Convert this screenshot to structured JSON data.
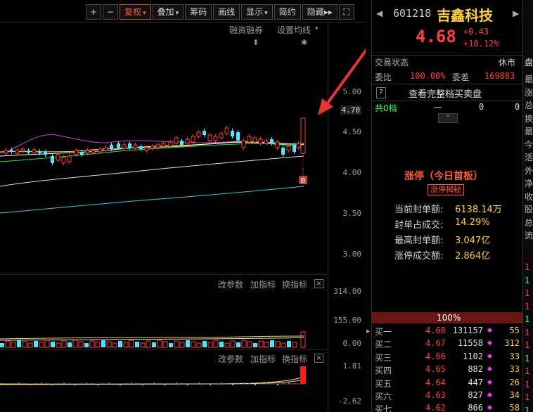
{
  "toolbar": {
    "items": [
      {
        "name": "zoom-in-button",
        "label": "+"
      },
      {
        "name": "zoom-out-button",
        "label": "−"
      },
      {
        "name": "restore-rights-button",
        "label": "复权",
        "caret": "▾"
      },
      {
        "name": "overlay-button",
        "label": "叠加",
        "caret": "▾"
      },
      {
        "name": "chips-button",
        "label": "筹码"
      },
      {
        "name": "draw-line-button",
        "label": "画线"
      },
      {
        "name": "display-button",
        "label": "显示",
        "caret": "▾"
      },
      {
        "name": "simple-button",
        "label": "简约"
      },
      {
        "name": "hide-button",
        "label": "隐藏▸▸"
      },
      {
        "name": "fullscreen-button",
        "label": "⛶"
      }
    ]
  },
  "chart": {
    "margin_trading_label": "融资融券",
    "ma_settings_label": "设置均线",
    "price_ticks": [
      "5.00",
      "4.70",
      "4.50",
      "4.00",
      "3.50",
      "3.00"
    ],
    "buy_marker": "B",
    "volume_ticks": [
      "314.00",
      "155.00",
      "0.00"
    ],
    "macd_ticks": [
      "1.81",
      "-2.62"
    ],
    "panel_links": {
      "edit_params": "改参数",
      "add_indicator": "加指标",
      "switch_indicator": "换指标",
      "close": "×"
    }
  },
  "quote": {
    "code": "601218",
    "name": "吉鑫科技",
    "price": "4.68",
    "change": "+0.43",
    "change_pct": "+10.12%",
    "trade_status_label": "交易状态",
    "trade_status_value": "休市",
    "ratio_label": "委比",
    "ratio_value": "100.00%",
    "diff_label": "委差",
    "diff_value": "169883",
    "view_full_label": "查看完整档买卖盘",
    "help_icon": "?",
    "sell_total_label": "共0档",
    "sell_dash": "—",
    "sell_zero1": "0",
    "sell_zero2": "0",
    "limit_up_title": "涨停（今日首板）",
    "limit_up_reveal": "涨停揭秘",
    "seal_amount_label": "当前封单额:",
    "seal_amount_value": "6138.14万",
    "seal_ratio_label": "封单占成交:",
    "seal_ratio_value": "14.29%",
    "max_seal_label": "最高封单额:",
    "max_seal_value": "3.047亿",
    "limit_turnover_label": "涨停成交额:",
    "limit_turnover_value": "2.864亿",
    "buy_bar_pct": "100%",
    "bids": [
      {
        "label": "买一",
        "price": "4.68",
        "vol": "131157",
        "diamond": "◆",
        "count": "55"
      },
      {
        "label": "买二",
        "price": "4.67",
        "vol": "11558",
        "diamond": "◆",
        "count": "312"
      },
      {
        "label": "买三",
        "price": "4.66",
        "vol": "1102",
        "diamond": "◆",
        "count": "33"
      },
      {
        "label": "买四",
        "price": "4.65",
        "vol": "882",
        "diamond": "◆",
        "count": "33"
      },
      {
        "label": "买五",
        "price": "4.64",
        "vol": "447",
        "diamond": "◆",
        "count": "26"
      },
      {
        "label": "买六",
        "price": "4.63",
        "vol": "827",
        "diamond": "◆",
        "count": "34"
      },
      {
        "label": "买七",
        "price": "4.62",
        "vol": "866",
        "diamond": "◆",
        "count": "58"
      }
    ]
  },
  "far_right": {
    "tab": "盘",
    "chars": [
      "最",
      "涨",
      "总",
      "换",
      "最",
      "今",
      "活",
      "外",
      "净",
      "收",
      "股",
      "总",
      "流"
    ],
    "nums": [
      "1",
      "1",
      "1",
      "1",
      "1",
      "1",
      "1",
      "1",
      "1",
      "1",
      "1",
      "1"
    ]
  },
  "colors": {
    "up": "#ff4040",
    "down": "#33ff66",
    "cyan": "#52e5ff",
    "yellow": "#ffd23d",
    "magenta": "#ff3cff",
    "accent_orange": "#ff5a3a"
  }
}
